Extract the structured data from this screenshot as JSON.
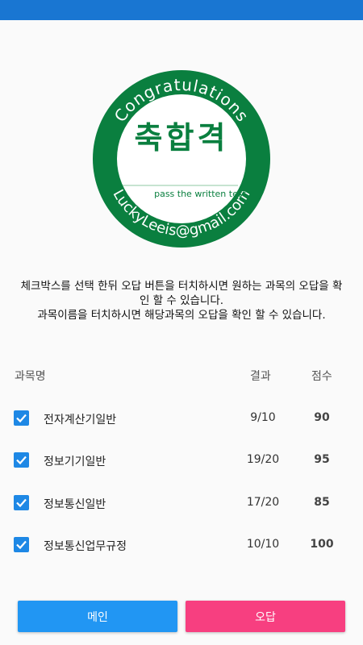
{
  "badge": {
    "top_text": "Congratulations",
    "center_text": "축합격",
    "sub_text": "pass the written test",
    "bottom_text": "LuckyLeeis@gmail.com",
    "color": "#0a7f3f"
  },
  "instruction": {
    "line1": "체크박스를 선택 한뒤 오답 버튼을 터치하시면 원하는 과목의 오답을 확인 할 수 있습니다.",
    "line2": "과목이름을 터치하시면 해당과목의 오답을 확인 할 수 있습니다."
  },
  "table": {
    "headers": {
      "subject": "과목명",
      "result": "결과",
      "score": "점수"
    },
    "rows": [
      {
        "subject": "전자계산기일반",
        "result": "9/10",
        "score": "90",
        "checked": true
      },
      {
        "subject": "정보기기일반",
        "result": "19/20",
        "score": "95",
        "checked": true
      },
      {
        "subject": "정보통신일반",
        "result": "17/20",
        "score": "85",
        "checked": true
      },
      {
        "subject": "정보통신업무규정",
        "result": "10/10",
        "score": "100",
        "checked": true
      }
    ]
  },
  "buttons": {
    "main": "메인",
    "wrong": "오답"
  },
  "colors": {
    "status_bar": "#1976d2",
    "main_button": "#2196f3",
    "wrong_button": "#f73f80",
    "checkbox": "#1e88e5"
  }
}
